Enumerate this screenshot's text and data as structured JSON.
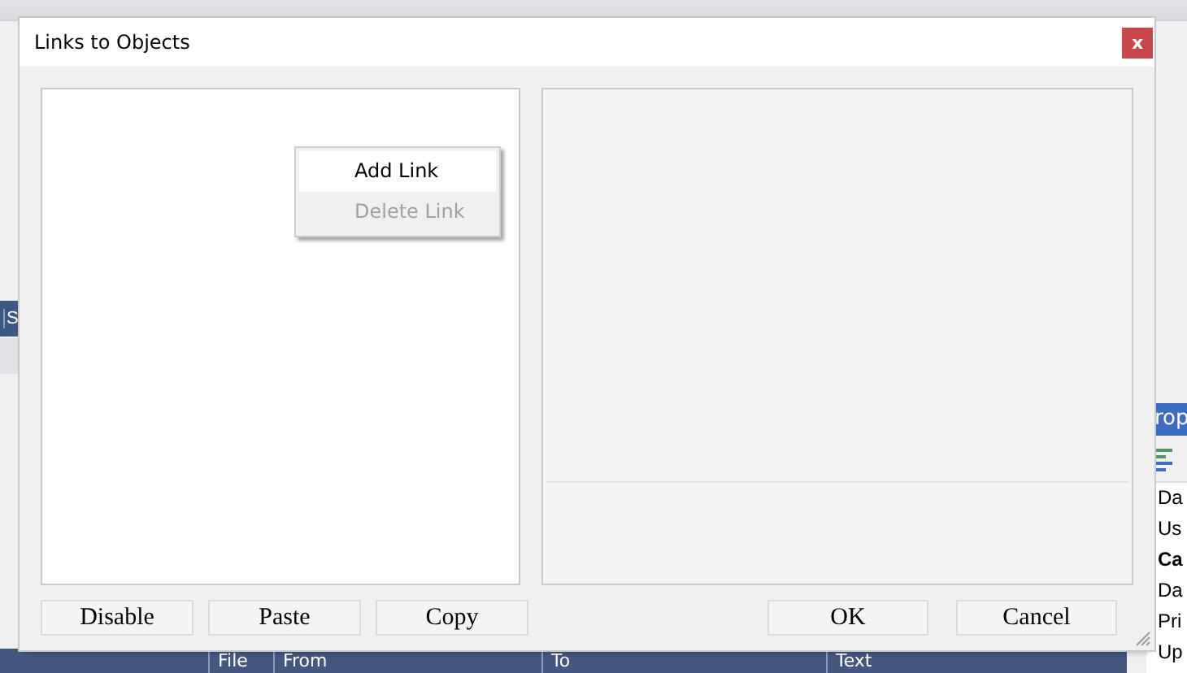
{
  "background_app": {
    "side_tab": {
      "label": "S"
    },
    "properties_panel": {
      "title": "rop",
      "items": [
        {
          "label": "Da",
          "bold": false
        },
        {
          "label": "Us",
          "bold": false
        },
        {
          "label": "Ca",
          "bold": true
        },
        {
          "label": "Da",
          "bold": false
        },
        {
          "label": "Pri",
          "bold": false
        },
        {
          "label": "Up",
          "bold": false
        }
      ]
    },
    "grid": {
      "columns": [
        "File",
        "From",
        "To",
        "Text"
      ]
    }
  },
  "dialog": {
    "title": "Links to Objects",
    "close": "x",
    "context_menu": {
      "items": [
        {
          "label": "Add Link",
          "selected": true,
          "disabled": false
        },
        {
          "label": "Delete Link",
          "selected": false,
          "disabled": true
        }
      ]
    },
    "buttons_left": [
      "Disable",
      "Paste",
      "Copy"
    ],
    "buttons_right": [
      "OK",
      "Cancel"
    ]
  }
}
